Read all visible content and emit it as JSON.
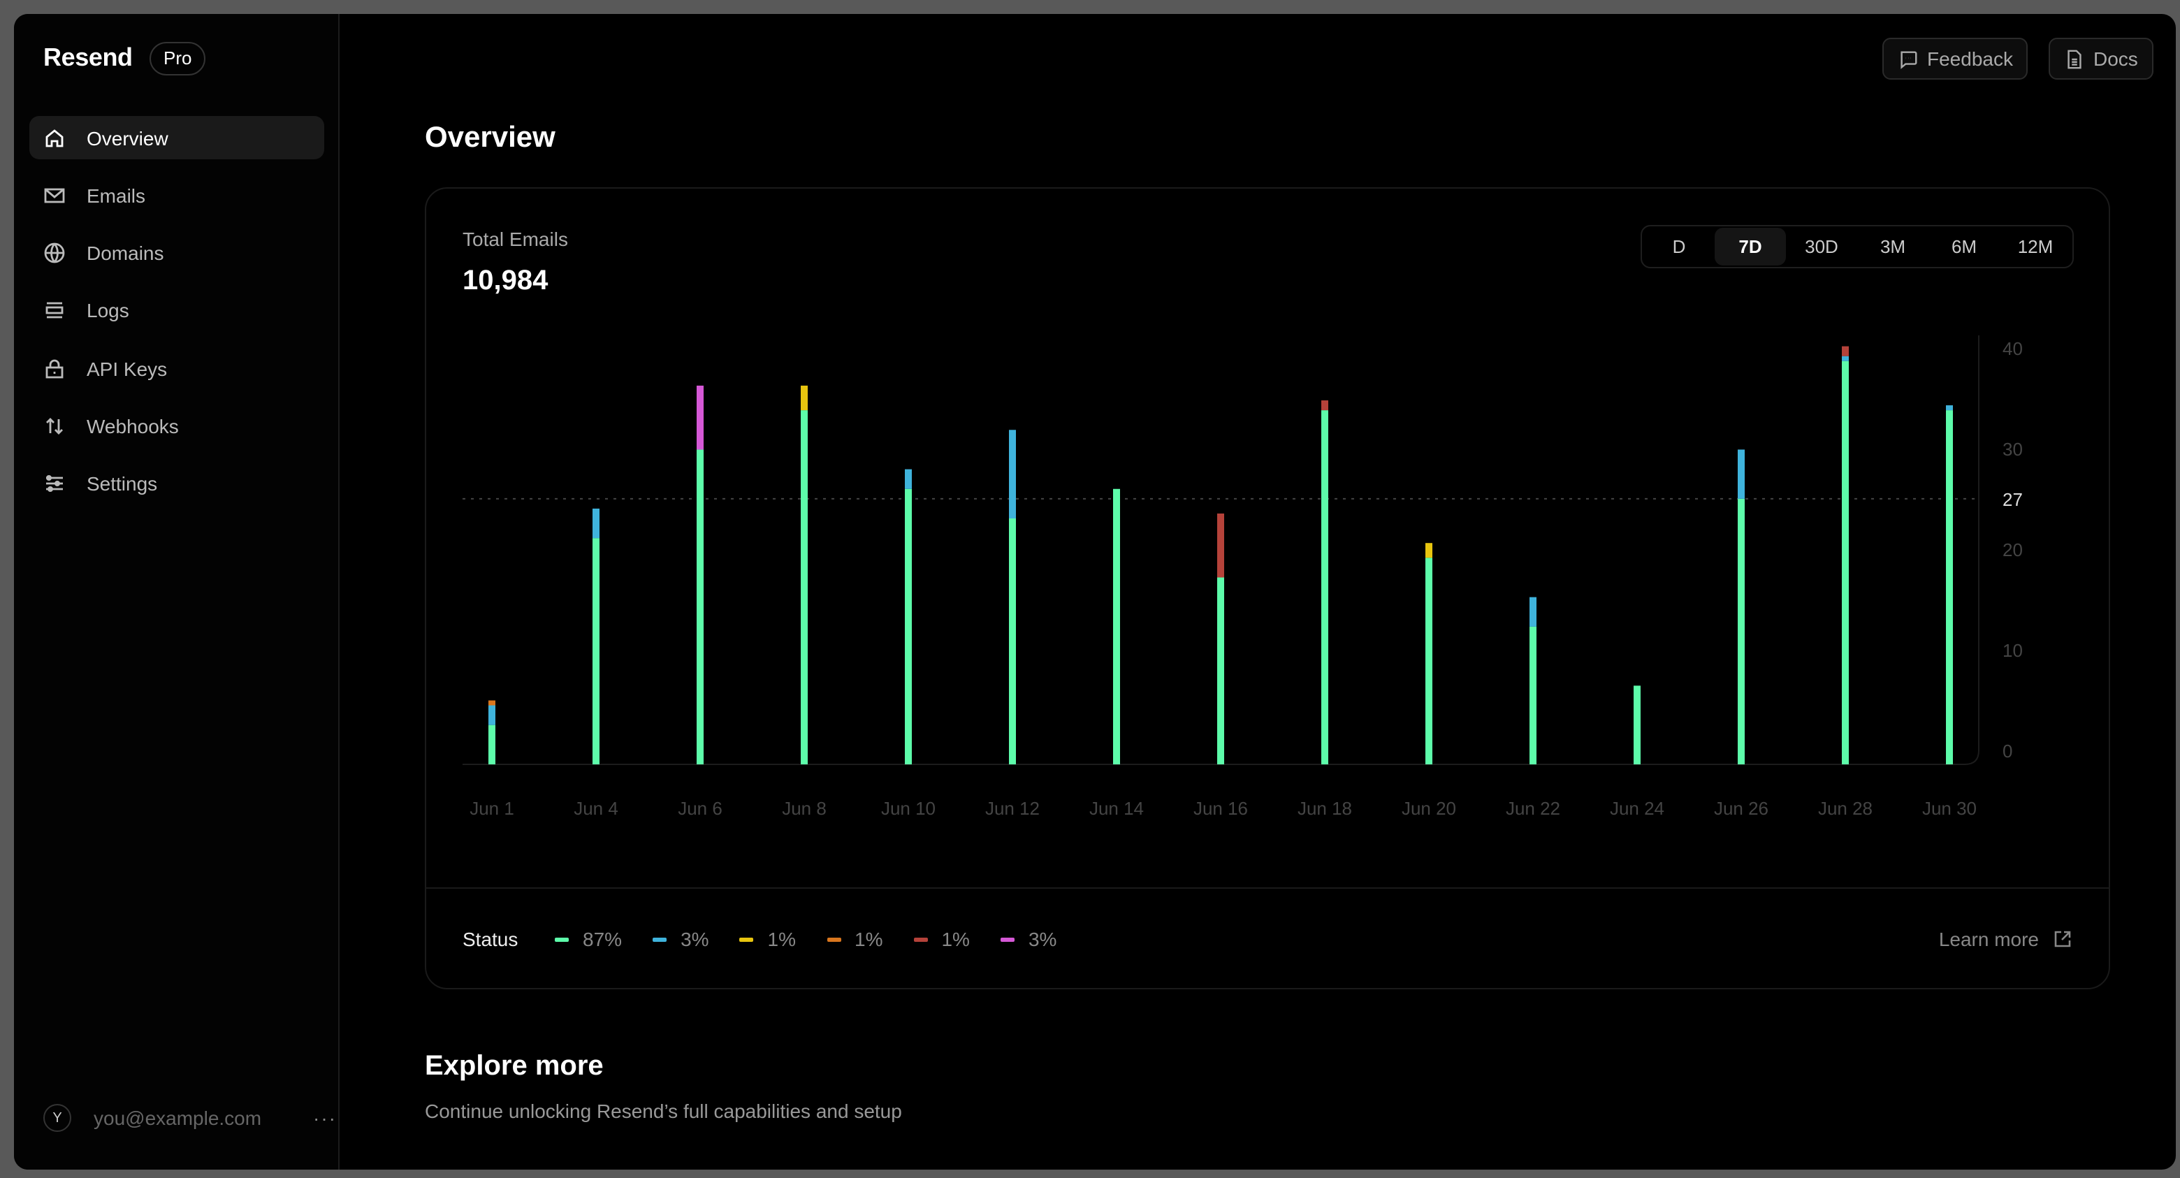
{
  "brand": {
    "name": "Resend",
    "plan": "Pro"
  },
  "sidebar": {
    "items": [
      {
        "label": "Overview",
        "icon": "home-icon",
        "active": true
      },
      {
        "label": "Emails",
        "icon": "mail-icon"
      },
      {
        "label": "Domains",
        "icon": "globe-icon"
      },
      {
        "label": "Logs",
        "icon": "list-icon"
      },
      {
        "label": "API Keys",
        "icon": "lock-icon"
      },
      {
        "label": "Webhooks",
        "icon": "arrows-up-down-icon"
      },
      {
        "label": "Settings",
        "icon": "sliders-icon"
      }
    ],
    "user": {
      "initial": "Y",
      "email": "you@example.com",
      "more": "···"
    }
  },
  "header": {
    "feedback": "Feedback",
    "docs": "Docs"
  },
  "page": {
    "title": "Overview"
  },
  "card": {
    "label": "Total Emails",
    "value": "10,984",
    "periods": [
      "D",
      "7D",
      "30D",
      "3M",
      "6M",
      "12M"
    ],
    "active_period": "7D",
    "status_label": "Status",
    "learn_more": "Learn more",
    "legend": [
      {
        "pct": "87%",
        "color": "#5dfcaa"
      },
      {
        "pct": "3%",
        "color": "#3fb3dc"
      },
      {
        "pct": "1%",
        "color": "#e8c50f"
      },
      {
        "pct": "1%",
        "color": "#d9761e"
      },
      {
        "pct": "1%",
        "color": "#b5423a"
      },
      {
        "pct": "3%",
        "color": "#d558d6"
      }
    ]
  },
  "chart_data": {
    "type": "bar",
    "stacked": true,
    "categories": [
      "Jun 1",
      "Jun 4",
      "Jun 6",
      "Jun 8",
      "Jun 10",
      "Jun 12",
      "Jun 14",
      "Jun 16",
      "Jun 18",
      "Jun 20",
      "Jun 22",
      "Jun 24",
      "Jun 26",
      "Jun 28",
      "Jun 30"
    ],
    "series": [
      {
        "color": "#5dfcaa",
        "values": [
          4,
          23,
          32,
          36,
          28,
          25,
          28,
          19,
          36,
          21,
          14,
          8,
          27,
          41,
          36
        ]
      },
      {
        "color": "#3fb3dc",
        "values": [
          2,
          3,
          0,
          0,
          2,
          9,
          0,
          0,
          0,
          0,
          3,
          0,
          5,
          0.5,
          0.5
        ]
      },
      {
        "color": "#e8c50f",
        "values": [
          0,
          0,
          0,
          2.5,
          0,
          0,
          0,
          0,
          0,
          1.5,
          0,
          0,
          0,
          0,
          0
        ]
      },
      {
        "color": "#d9761e",
        "values": [
          0.5,
          0,
          0,
          0,
          0,
          0,
          0,
          0,
          0,
          0,
          0,
          0,
          0,
          0,
          0
        ]
      },
      {
        "color": "#b5423a",
        "values": [
          0,
          0,
          0,
          0,
          0,
          0,
          0,
          6.5,
          1,
          0,
          0,
          0,
          0,
          1,
          0
        ]
      },
      {
        "color": "#d558d6",
        "values": [
          0,
          0,
          6.5,
          0,
          0,
          0,
          0,
          0,
          0,
          0,
          0,
          0,
          0,
          0,
          0
        ]
      }
    ],
    "y_ticks": [
      0,
      10,
      20,
      30,
      40
    ],
    "average": 27,
    "ylim": [
      0,
      42
    ],
    "grid": false,
    "legend": "bottom-left"
  },
  "explore": {
    "title": "Explore more",
    "subtitle": "Continue unlocking Resend’s full capabilities and setup"
  }
}
